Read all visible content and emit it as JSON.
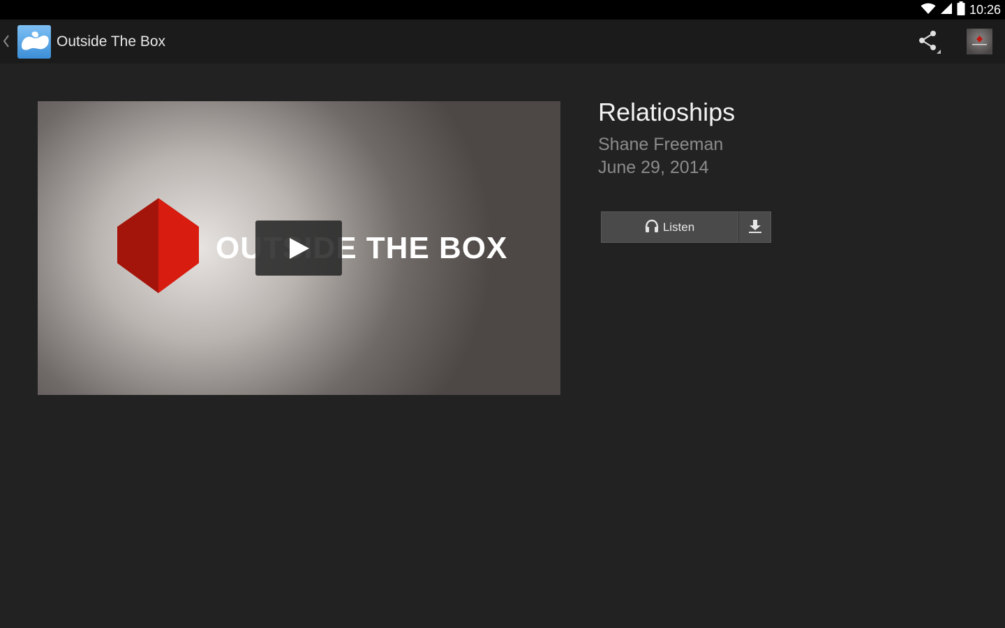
{
  "status_bar": {
    "time": "10:26",
    "icons": [
      "wifi-icon",
      "cell-signal-icon",
      "battery-icon"
    ]
  },
  "action_bar": {
    "back_icon": "chevron-left-icon",
    "app_icon": "app-logo-icon",
    "app_title": "Outside The Box",
    "share_icon": "share-icon",
    "thumbnail": "series-thumbnail"
  },
  "video": {
    "logo_text": "OUTSIDE THE BOX",
    "play_icon": "play-icon",
    "cube_color": "#c0170e"
  },
  "sermon": {
    "title": "Relatioships",
    "speaker": "Shane Freeman",
    "date": "June 29, 2014"
  },
  "actions": {
    "listen_label": "Listen",
    "listen_icon": "headphones-icon",
    "download_icon": "download-icon"
  }
}
